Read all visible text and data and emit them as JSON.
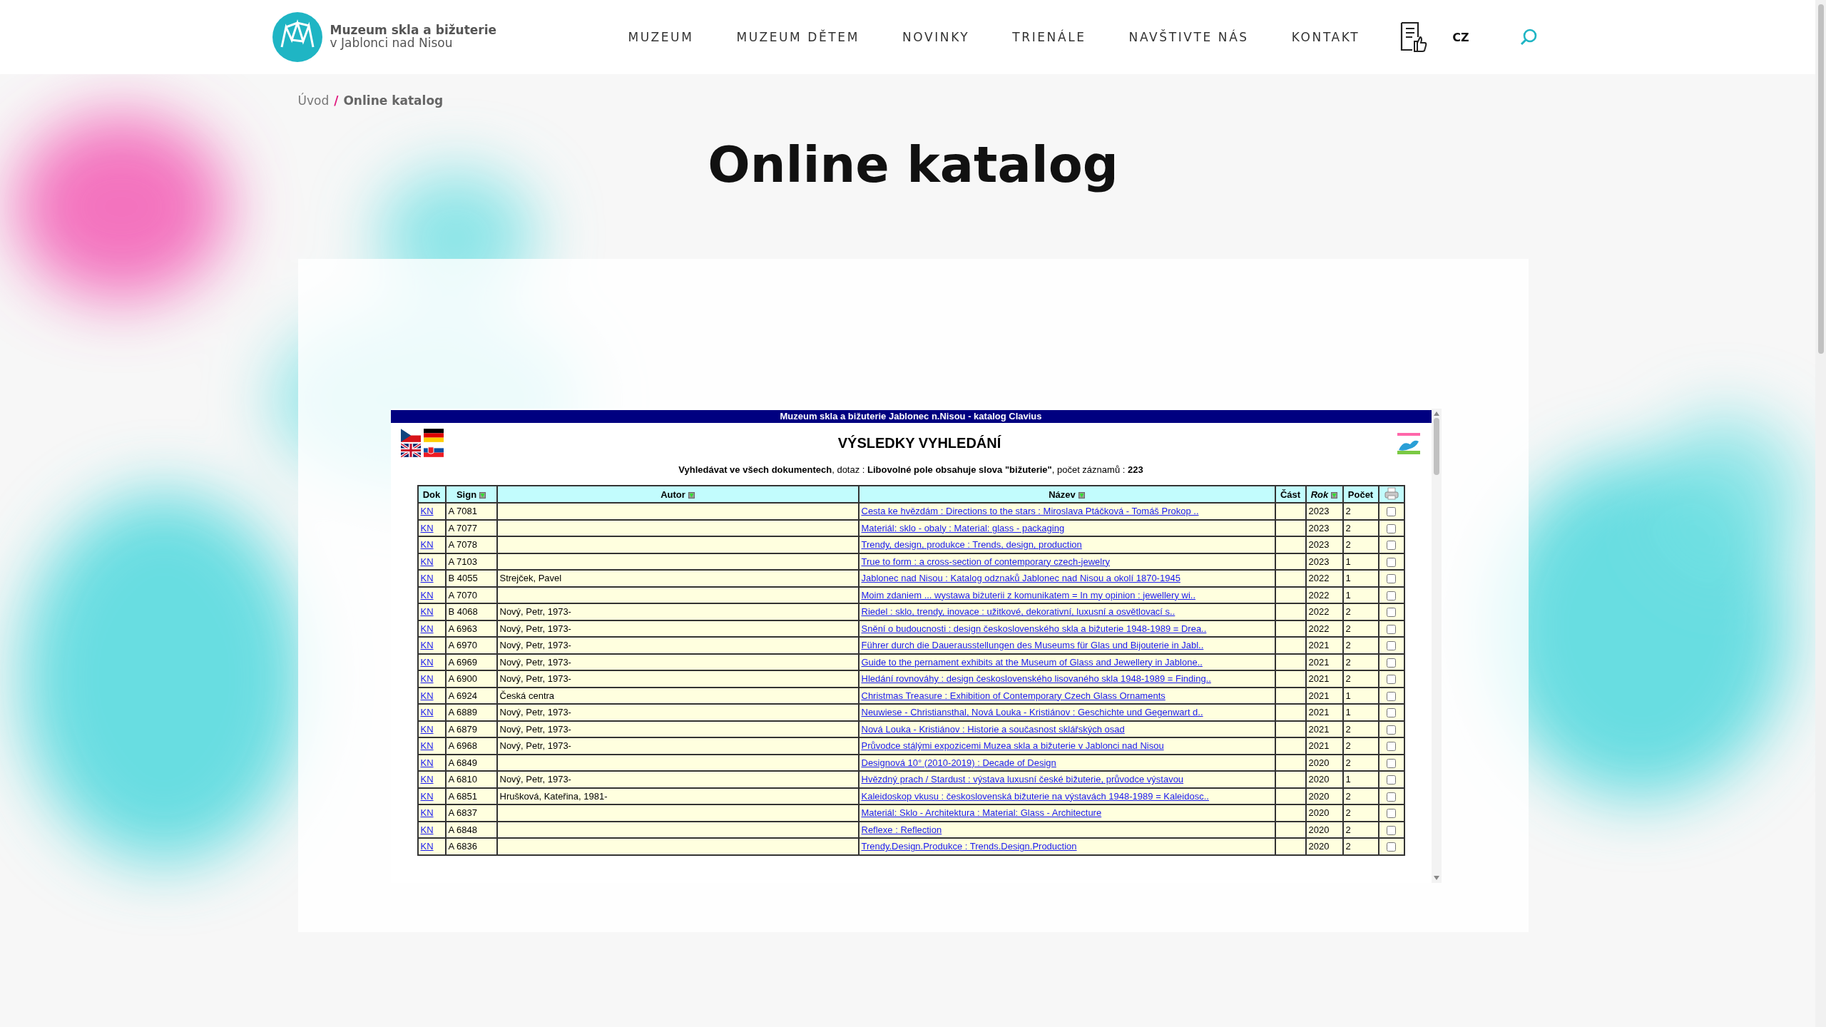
{
  "header": {
    "logo": {
      "line1": "Muzeum skla a bižuterie",
      "line2": "v Jablonci nad Nisou"
    },
    "nav": [
      {
        "label": "MUZEUM"
      },
      {
        "label": "MUZEUM DĚTEM"
      },
      {
        "label": "NOVINKY"
      },
      {
        "label": "TRIENÁLE"
      },
      {
        "label": "NAVŠTIVTE NÁS"
      },
      {
        "label": "KONTAKT"
      }
    ],
    "language": {
      "label": "CZ",
      "selected": true
    }
  },
  "breadcrumb": {
    "items": [
      {
        "label": "Úvod",
        "current": false
      },
      {
        "label": "Online katalog",
        "current": true
      }
    ],
    "separator": "/"
  },
  "title": "Online katalog",
  "catalog": {
    "banner": "Muzeum skla a bižuterie Jablonec n.Nisou - katalog Clavius",
    "heading": "VÝSLEDKY VYHLEDÁNÍ",
    "query": "**Vyhledávat ve všech dokumentech**, dotaz : **Libovolné pole obsahuje slova \"bižuterie\"**, počet záznamů : **223**",
    "columns": [
      {
        "label": "Dok",
        "sortable": false,
        "sorted": false
      },
      {
        "label": "Sign",
        "sortable": true,
        "sorted": false
      },
      {
        "label": "Autor",
        "sortable": true,
        "sorted": false
      },
      {
        "label": "Název",
        "sortable": true,
        "sorted": false
      },
      {
        "label": "Část",
        "sortable": false,
        "sorted": false
      },
      {
        "label": "Rok",
        "sortable": true,
        "sorted": true
      },
      {
        "label": "Počet",
        "sortable": false,
        "sorted": false
      }
    ],
    "rows": [
      {
        "dok": "KN",
        "sign": "A 7081",
        "autor": "",
        "nazev": "Cesta ke hvězdám : Directions to the stars : Miroslava Ptáčková - Tomáš Prokop ..",
        "rok": "2023",
        "pocet": "2",
        "checked": false
      },
      {
        "dok": "KN",
        "sign": "A 7077",
        "autor": "",
        "nazev": "Materiál: sklo - obaly : Material: glass - packaging",
        "rok": "2023",
        "pocet": "2",
        "checked": false
      },
      {
        "dok": "KN",
        "sign": "A 7078",
        "autor": "",
        "nazev": "Trendy, design, produkce : Trends, design, production",
        "rok": "2023",
        "pocet": "2",
        "checked": false
      },
      {
        "dok": "KN",
        "sign": "A 7103",
        "autor": "",
        "nazev": "True to form : a cross-section of contemporary czech-jewelry",
        "rok": "2023",
        "pocet": "1",
        "checked": false
      },
      {
        "dok": "KN",
        "sign": "B 4055",
        "autor": "Strejček, Pavel",
        "nazev": "Jablonec nad Nisou : Katalog odznaků Jablonec nad Nisou a okolí 1870-1945",
        "rok": "2022",
        "pocet": "1",
        "checked": false
      },
      {
        "dok": "KN",
        "sign": "A 7070",
        "autor": "",
        "nazev": "Moim zdaniem ... wystawa biżuterii z komunikatem = In my opinion : jewellery wi..",
        "rok": "2022",
        "pocet": "1",
        "checked": false
      },
      {
        "dok": "KN",
        "sign": "B 4068",
        "autor": "Nový, Petr, 1973-",
        "nazev": "Riedel : sklo, trendy, inovace : užitkové, dekorativní, luxusní a osvětlovací s..",
        "rok": "2022",
        "pocet": "2",
        "checked": false
      },
      {
        "dok": "KN",
        "sign": "A 6963",
        "autor": "Nový, Petr, 1973-",
        "nazev": "Snění o budoucnosti : design československého skla a bižuterie 1948-1989 = Drea..",
        "rok": "2022",
        "pocet": "2",
        "checked": false
      },
      {
        "dok": "KN",
        "sign": "A 6970",
        "autor": "Nový, Petr, 1973-",
        "nazev": "Führer durch die Dauerausstellungen des Museums für Glas und Bijouterie in Jabl..",
        "rok": "2021",
        "pocet": "2",
        "checked": false
      },
      {
        "dok": "KN",
        "sign": "A 6969",
        "autor": "Nový, Petr, 1973-",
        "nazev": "Guide to the pernament exhibits at the Museum of Glass and Jewellery in Jablone..",
        "rok": "2021",
        "pocet": "2",
        "checked": false
      },
      {
        "dok": "KN",
        "sign": "A 6900",
        "autor": "Nový, Petr, 1973-",
        "nazev": "Hledání rovnováhy : design československého lisovaného skla 1948-1989 = Finding..",
        "rok": "2021",
        "pocet": "2",
        "checked": false
      },
      {
        "dok": "KN",
        "sign": "A 6924",
        "autor": "Česká centra",
        "nazev": "Christmas Treasure : Exhibition of Contemporary Czech Glass Ornaments",
        "rok": "2021",
        "pocet": "1",
        "checked": false
      },
      {
        "dok": "KN",
        "sign": "A 6889",
        "autor": "Nový, Petr, 1973-",
        "nazev": "Neuwiese - Christiansthal, Nová Louka - Kristiánov : Geschichte und Gegenwart d..",
        "rok": "2021",
        "pocet": "1",
        "checked": false
      },
      {
        "dok": "KN",
        "sign": "A 6879",
        "autor": "Nový, Petr, 1973-",
        "nazev": "Nová Louka - Kristiánov : Historie a současnost sklářských osad",
        "rok": "2021",
        "pocet": "2",
        "checked": false
      },
      {
        "dok": "KN",
        "sign": "A 6968",
        "autor": "Nový, Petr, 1973-",
        "nazev": "Průvodce stálými expozicemi Muzea skla a bižuterie v Jablonci nad Nisou",
        "rok": "2021",
        "pocet": "2",
        "checked": false
      },
      {
        "dok": "KN",
        "sign": "A 6849",
        "autor": "",
        "nazev": "Designová 10° (2010-2019) : Decade of Design",
        "rok": "2020",
        "pocet": "2",
        "checked": false
      },
      {
        "dok": "KN",
        "sign": "A 6810",
        "autor": "Nový, Petr, 1973-",
        "nazev": "Hvězdný prach / Stardust : výstava luxusní české bižuterie, průvodce výstavou",
        "rok": "2020",
        "pocet": "1",
        "checked": false
      },
      {
        "dok": "KN",
        "sign": "A 6851",
        "autor": "Hrušková, Kateřina, 1981-",
        "nazev": "Kaleidoskop vkusu : československá bižuterie na výstavách 1948-1989 = Kaleidosc..",
        "rok": "2020",
        "pocet": "2",
        "checked": false
      },
      {
        "dok": "KN",
        "sign": "A 6837",
        "autor": "",
        "nazev": "Materiál: Sklo - Architektura : Material: Glass - Architecture",
        "rok": "2020",
        "pocet": "2",
        "checked": false
      },
      {
        "dok": "KN",
        "sign": "A 6848",
        "autor": "",
        "nazev": "Reflexe : Reflection",
        "rok": "2020",
        "pocet": "2",
        "checked": false
      },
      {
        "dok": "KN",
        "sign": "A 6836",
        "autor": "",
        "nazev": "Trendy.Design.Produkce : Trends.Design.Production",
        "rok": "2020",
        "pocet": "2",
        "checked": false
      }
    ]
  }
}
